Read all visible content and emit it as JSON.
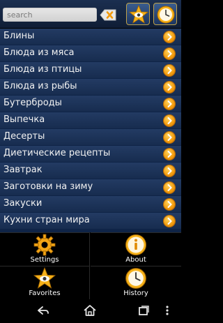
{
  "search": {
    "placeholder": "search"
  },
  "list": {
    "items": [
      {
        "label": "Блины"
      },
      {
        "label": "Блюда из мяса"
      },
      {
        "label": "Блюда из птицы"
      },
      {
        "label": "Блюда из рыбы"
      },
      {
        "label": "Бутерброды"
      },
      {
        "label": "Выпечка"
      },
      {
        "label": "Десерты"
      },
      {
        "label": "Диетические рецепты"
      },
      {
        "label": "Завтрак"
      },
      {
        "label": "Заготовки на зиму"
      },
      {
        "label": "Закуски"
      },
      {
        "label": "Кухни стран мира"
      }
    ]
  },
  "panel": {
    "settings_label": "Settings",
    "about_label": "About",
    "favorites_label": "Favorites",
    "history_label": "History"
  },
  "icons": {
    "clear": "clear-search-icon",
    "favorites": "star-eye-icon",
    "history": "clock-icon",
    "settings": "gear-icon",
    "about": "info-icon",
    "row_arrow": "chevron-right-icon",
    "nav_back": "back-icon",
    "nav_home": "home-icon",
    "nav_recent": "recent-apps-icon",
    "nav_menu": "menu-dots-icon"
  },
  "colors": {
    "accent": "#f29a0c",
    "list_bg": "#1b3157",
    "text": "#f2f2f2"
  }
}
